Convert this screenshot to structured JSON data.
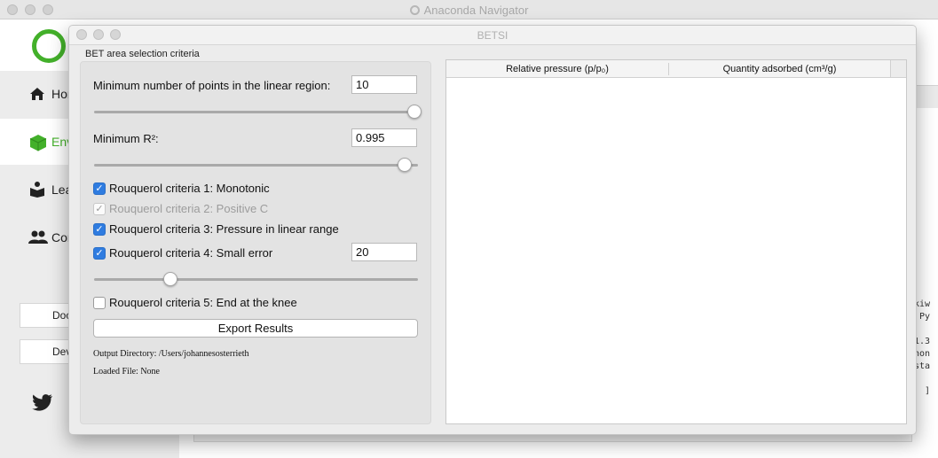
{
  "navigator": {
    "window_title": "Anaconda Navigator",
    "sidebar_items": [
      {
        "label": "Hor",
        "icon": "home-icon"
      },
      {
        "label": "Env",
        "icon": "cube-icon"
      },
      {
        "label": "Lea",
        "icon": "book-icon"
      },
      {
        "label": "Cor",
        "icon": "people-icon"
      }
    ],
    "buttons": [
      {
        "label": "Doc"
      },
      {
        "label": "Dev"
      }
    ],
    "social_icon": "twitter-icon",
    "console_lines": "kiw\n Py\n\n1.3\nhon\nsta\n\n  ]",
    "accent_color": "#43b02a"
  },
  "betsi": {
    "window_title": "BETSI",
    "group_title": "BET area selection criteria",
    "min_points": {
      "label": "Minimum number of points in the linear region:",
      "value": "10",
      "slider_fraction": 1.0
    },
    "min_r2": {
      "label": "Minimum R²:",
      "value": "0.995",
      "slider_fraction": 0.97
    },
    "criteria": [
      {
        "label": "Rouquerol criteria 1: Monotonic",
        "state": "checked"
      },
      {
        "label": "Rouquerol criteria 2: Positive C",
        "state": "checked-disabled"
      },
      {
        "label": "Rouquerol criteria 3: Pressure in linear range",
        "state": "checked"
      },
      {
        "label": "Rouquerol criteria 4: Small error",
        "state": "checked"
      },
      {
        "label": "Rouquerol criteria 5: End at the knee",
        "state": "unchecked"
      }
    ],
    "small_error": {
      "value": "20",
      "slider_fraction": 0.23
    },
    "export_label": "Export Results",
    "output_directory": "Output Directory: /Users/johannesosterrieth",
    "loaded_file": "Loaded File: None",
    "table": {
      "columns": [
        "Relative pressure (p/p₀)",
        "Quantity adsorbed (cm³/g)"
      ],
      "rows": []
    },
    "checkbox_color": "#2f7ce0"
  }
}
